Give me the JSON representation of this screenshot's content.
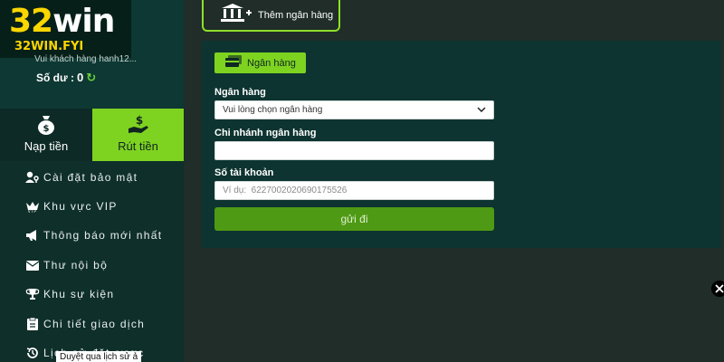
{
  "logo": {
    "brand_number": "32",
    "brand_word": "win",
    "domain": "32WIN.FYI"
  },
  "account": {
    "welcome_text": "Vui khách hàng hanh12...",
    "balance_label": "Số dư :",
    "balance_value": "0"
  },
  "tabs": [
    {
      "label": "Nạp tiền",
      "icon": "money-bag-icon",
      "active": false
    },
    {
      "label": "Rút tiền",
      "icon": "hand-coin-icon",
      "active": true
    }
  ],
  "menu": [
    {
      "label": "Cài đặt bảo mật",
      "icon": "user-key-icon"
    },
    {
      "label": "Khu vực VIP",
      "icon": "vip-crown-icon"
    },
    {
      "label": "Thông báo mới nhất",
      "icon": "megaphone-icon"
    },
    {
      "label": "Thư nội bộ",
      "icon": "envelope-icon"
    },
    {
      "label": "Khu sự kiện",
      "icon": "trophy-icon"
    },
    {
      "label": "Chi tiết giao dịch",
      "icon": "clipboard-icon"
    },
    {
      "label": "Lịch sử đặt cược",
      "icon": "history-icon"
    }
  ],
  "tooltip": "Duyệt qua lịch sử ả",
  "add_bank": {
    "label": "Thêm ngân hàng",
    "icon": "bank-plus-icon"
  },
  "form": {
    "chip_label": "Ngân hàng",
    "bank_label": "Ngân hàng",
    "bank_select_value": "Vui lòng chọn ngân hàng",
    "branch_label": "Chi nhánh ngân hàng",
    "branch_value": "",
    "account_label": "Số tài khoản",
    "account_placeholder": "Ví dụ:  6227002020690175526",
    "submit_label": "gửi đi"
  },
  "colors": {
    "accent": "#7ed321",
    "submit": "#4e9a14",
    "brand_yellow": "#fbd600"
  }
}
